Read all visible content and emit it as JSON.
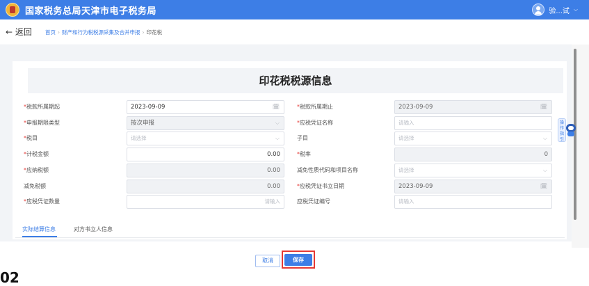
{
  "header": {
    "app_title": "国家税务总局天津市电子税务局",
    "user_name": "验...试",
    "user_caret": "⌵"
  },
  "nav": {
    "back_label": "← 返回",
    "breadcrumb": [
      "首页",
      "财产和行为税税源采集及合并申报",
      "印花税"
    ],
    "separator": "›"
  },
  "form": {
    "title": "印花税税源信息",
    "required_mark": "*",
    "calendar_icon": "🗓",
    "chevron_icon": "⌵",
    "rows": [
      {
        "left": {
          "label": "税款所属期起",
          "required": true,
          "value": "2023-09-09",
          "placeholder": "",
          "kind": "date",
          "disabled": false,
          "align": "left"
        },
        "right": {
          "label": "税款所属期止",
          "required": true,
          "value": "2023-09-09",
          "placeholder": "",
          "kind": "date",
          "disabled": true,
          "align": "left"
        }
      },
      {
        "left": {
          "label": "申报期限类型",
          "required": true,
          "value": "按次申报",
          "placeholder": "",
          "kind": "select",
          "disabled": true,
          "align": "left"
        },
        "right": {
          "label": "应税凭证名称",
          "required": true,
          "value": "",
          "placeholder": "请输入",
          "kind": "text",
          "disabled": false,
          "align": "left"
        }
      },
      {
        "left": {
          "label": "税目",
          "required": true,
          "value": "",
          "placeholder": "请选择",
          "kind": "select",
          "disabled": false,
          "align": "left"
        },
        "right": {
          "label": "子目",
          "required": false,
          "value": "",
          "placeholder": "请选择",
          "kind": "select",
          "disabled": false,
          "align": "left"
        }
      },
      {
        "left": {
          "label": "计税金额",
          "required": true,
          "value": "0.00",
          "placeholder": "",
          "kind": "text",
          "disabled": false,
          "align": "right"
        },
        "right": {
          "label": "税率",
          "required": true,
          "value": "0",
          "placeholder": "",
          "kind": "text",
          "disabled": true,
          "align": "right"
        }
      },
      {
        "left": {
          "label": "应纳税额",
          "required": true,
          "value": "0.00",
          "placeholder": "",
          "kind": "text",
          "disabled": true,
          "align": "right"
        },
        "right": {
          "label": "减免性质代码和项目名称",
          "required": false,
          "value": "",
          "placeholder": "请选择",
          "kind": "select",
          "disabled": false,
          "align": "left"
        }
      },
      {
        "left": {
          "label": "减免税额",
          "required": false,
          "value": "0.00",
          "placeholder": "",
          "kind": "text",
          "disabled": true,
          "align": "right"
        },
        "right": {
          "label": "应税凭证书立日期",
          "required": true,
          "value": "2023-09-09",
          "placeholder": "",
          "kind": "date",
          "disabled": true,
          "align": "left"
        }
      },
      {
        "left": {
          "label": "应税凭证数量",
          "required": true,
          "value": "",
          "placeholder": "请输入",
          "kind": "text",
          "disabled": false,
          "align": "right"
        },
        "right": {
          "label": "应税凭证编号",
          "required": false,
          "value": "",
          "placeholder": "请输入",
          "kind": "text",
          "disabled": false,
          "align": "left"
        }
      }
    ]
  },
  "tabs": [
    {
      "label": "实际结算信息",
      "active": true
    },
    {
      "label": "对方书立人信息",
      "active": false
    }
  ],
  "footer": {
    "cancel_label": "取消",
    "save_label": "保存"
  },
  "side_helper": {
    "label": "操作指引"
  },
  "step_number": "02",
  "colors": {
    "primary": "#3d7ee6",
    "required": "#e53935",
    "highlight_border": "#e53935"
  }
}
